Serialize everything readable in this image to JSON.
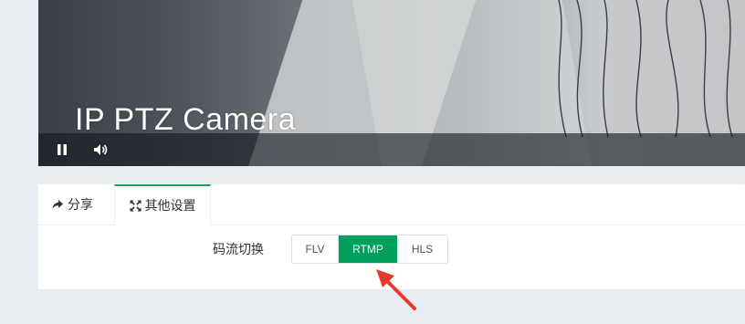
{
  "video": {
    "title": "IP PTZ Camera",
    "controls": {
      "pause_icon": "pause-icon",
      "volume_icon": "volume-icon"
    }
  },
  "tabs": [
    {
      "label": "分享",
      "icon": "share-icon",
      "active": false
    },
    {
      "label": "其他设置",
      "icon": "expand-icon",
      "active": true
    }
  ],
  "stream_switch": {
    "label": "码流切换",
    "options": [
      "FLV",
      "RTMP",
      "HLS"
    ],
    "selected": "RTMP"
  },
  "colors": {
    "accent": "#009f5d",
    "annotation_arrow": "#e8392f"
  }
}
